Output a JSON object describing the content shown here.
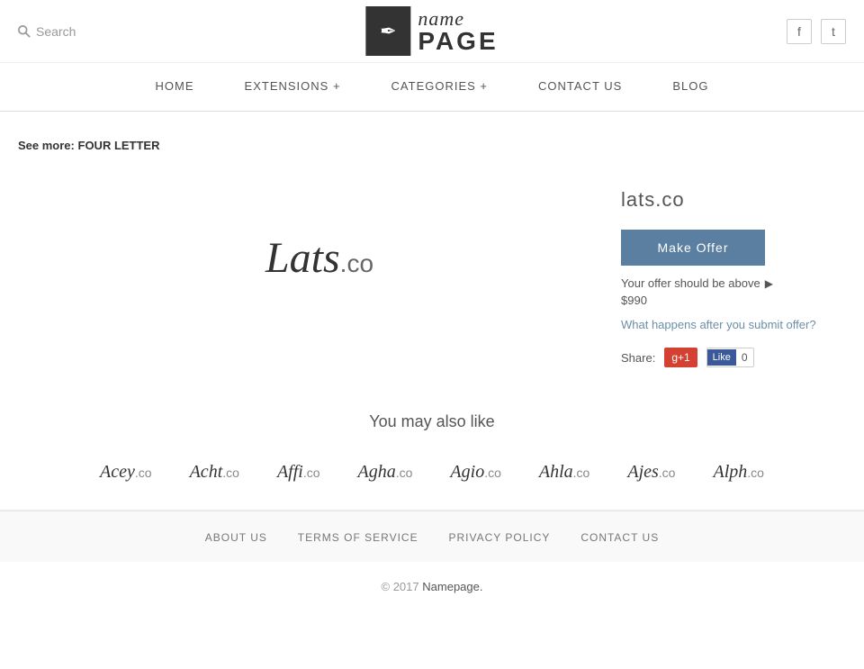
{
  "header": {
    "search_label": "Search",
    "search_placeholder": "Search",
    "social": [
      {
        "name": "facebook",
        "icon": "f"
      },
      {
        "name": "twitter",
        "icon": "t"
      }
    ]
  },
  "nav": {
    "items": [
      {
        "id": "home",
        "label": "HOME"
      },
      {
        "id": "extensions",
        "label": "EXTENSIONS +"
      },
      {
        "id": "categories",
        "label": "CATEGORIES +"
      },
      {
        "id": "contact",
        "label": "CONTACT US"
      },
      {
        "id": "blog",
        "label": "BLOG"
      }
    ]
  },
  "breadcrumb": {
    "prefix": "See more:",
    "link": "FOUR LETTER"
  },
  "domain": {
    "display_word": "Lats",
    "display_ext": ".co",
    "full_name": "lats.co",
    "offer_button": "Make Offer",
    "offer_hint": "Your offer should be above",
    "offer_price": "$990",
    "what_happens": "What happens after you submit offer?",
    "share_label": "Share:",
    "gplus": "g+1",
    "fb_like": "Like",
    "fb_count": "0"
  },
  "also_like": {
    "title": "You may also like",
    "items": [
      {
        "word": "Acey",
        "ext": ".co"
      },
      {
        "word": "Acht",
        "ext": ".co"
      },
      {
        "word": "Affi",
        "ext": ".co"
      },
      {
        "word": "Agha",
        "ext": ".co"
      },
      {
        "word": "Agio",
        "ext": ".co"
      },
      {
        "word": "Ahla",
        "ext": ".co"
      },
      {
        "word": "Ajes",
        "ext": ".co"
      },
      {
        "word": "Alph",
        "ext": ".co"
      }
    ]
  },
  "footer": {
    "links": [
      {
        "id": "about",
        "label": "ABOUT US"
      },
      {
        "id": "terms",
        "label": "TERMS OF SERVICE"
      },
      {
        "id": "privacy",
        "label": "PRIVACY POLICY"
      },
      {
        "id": "contact",
        "label": "CONTACT US"
      }
    ],
    "copy_prefix": "© 2017",
    "copy_brand": "Namepage.",
    "copy_suffix": ""
  },
  "logo": {
    "name_text": "name",
    "page_text": "PAGE"
  }
}
